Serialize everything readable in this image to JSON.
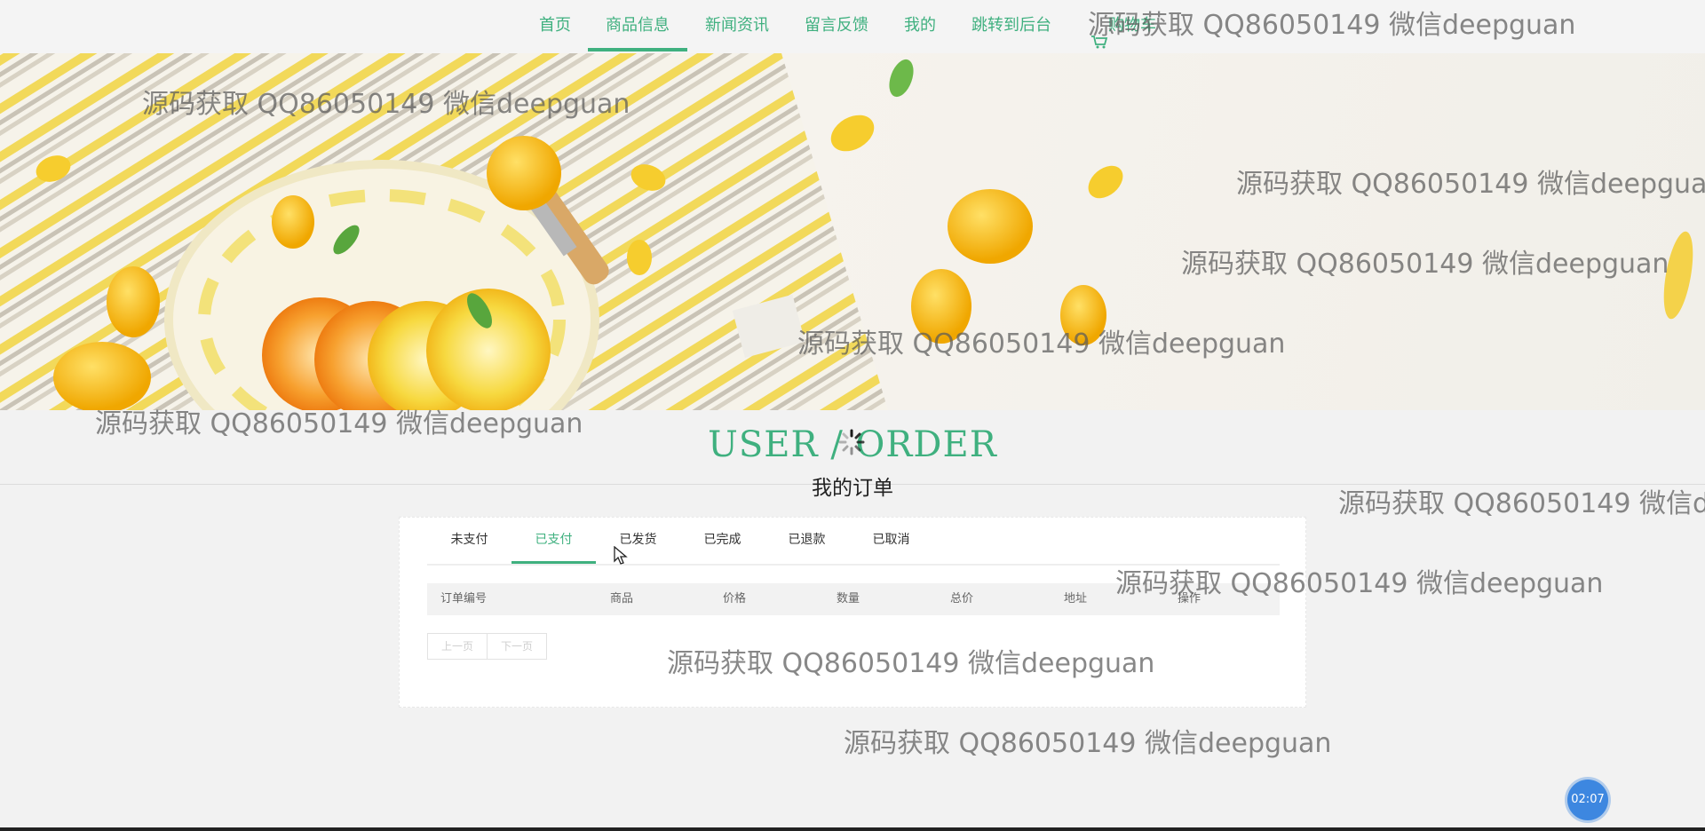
{
  "nav": {
    "items": [
      {
        "label": "首页"
      },
      {
        "label": "商品信息"
      },
      {
        "label": "新闻资讯"
      },
      {
        "label": "留言反馈"
      },
      {
        "label": "我的"
      },
      {
        "label": "跳转到后台"
      },
      {
        "label": "购物车"
      }
    ],
    "active": "商品信息"
  },
  "section": {
    "title": "USER / ORDER",
    "subtitle": "我的订单"
  },
  "tabs": [
    {
      "label": "未支付"
    },
    {
      "label": "已支付"
    },
    {
      "label": "已发货"
    },
    {
      "label": "已完成"
    },
    {
      "label": "已退款"
    },
    {
      "label": "已取消"
    }
  ],
  "active_tab": "已支付",
  "table": {
    "columns": [
      "订单编号",
      "商品",
      "价格",
      "数量",
      "总价",
      "地址",
      "操作"
    ],
    "rows": []
  },
  "pager": {
    "prev": "上一页",
    "next": "下一页"
  },
  "watermark": "源码获取 QQ86050149 微信deepguan",
  "timer": "02:07",
  "colors": {
    "accent": "#3fb07f",
    "timer": "#3d87e0"
  }
}
